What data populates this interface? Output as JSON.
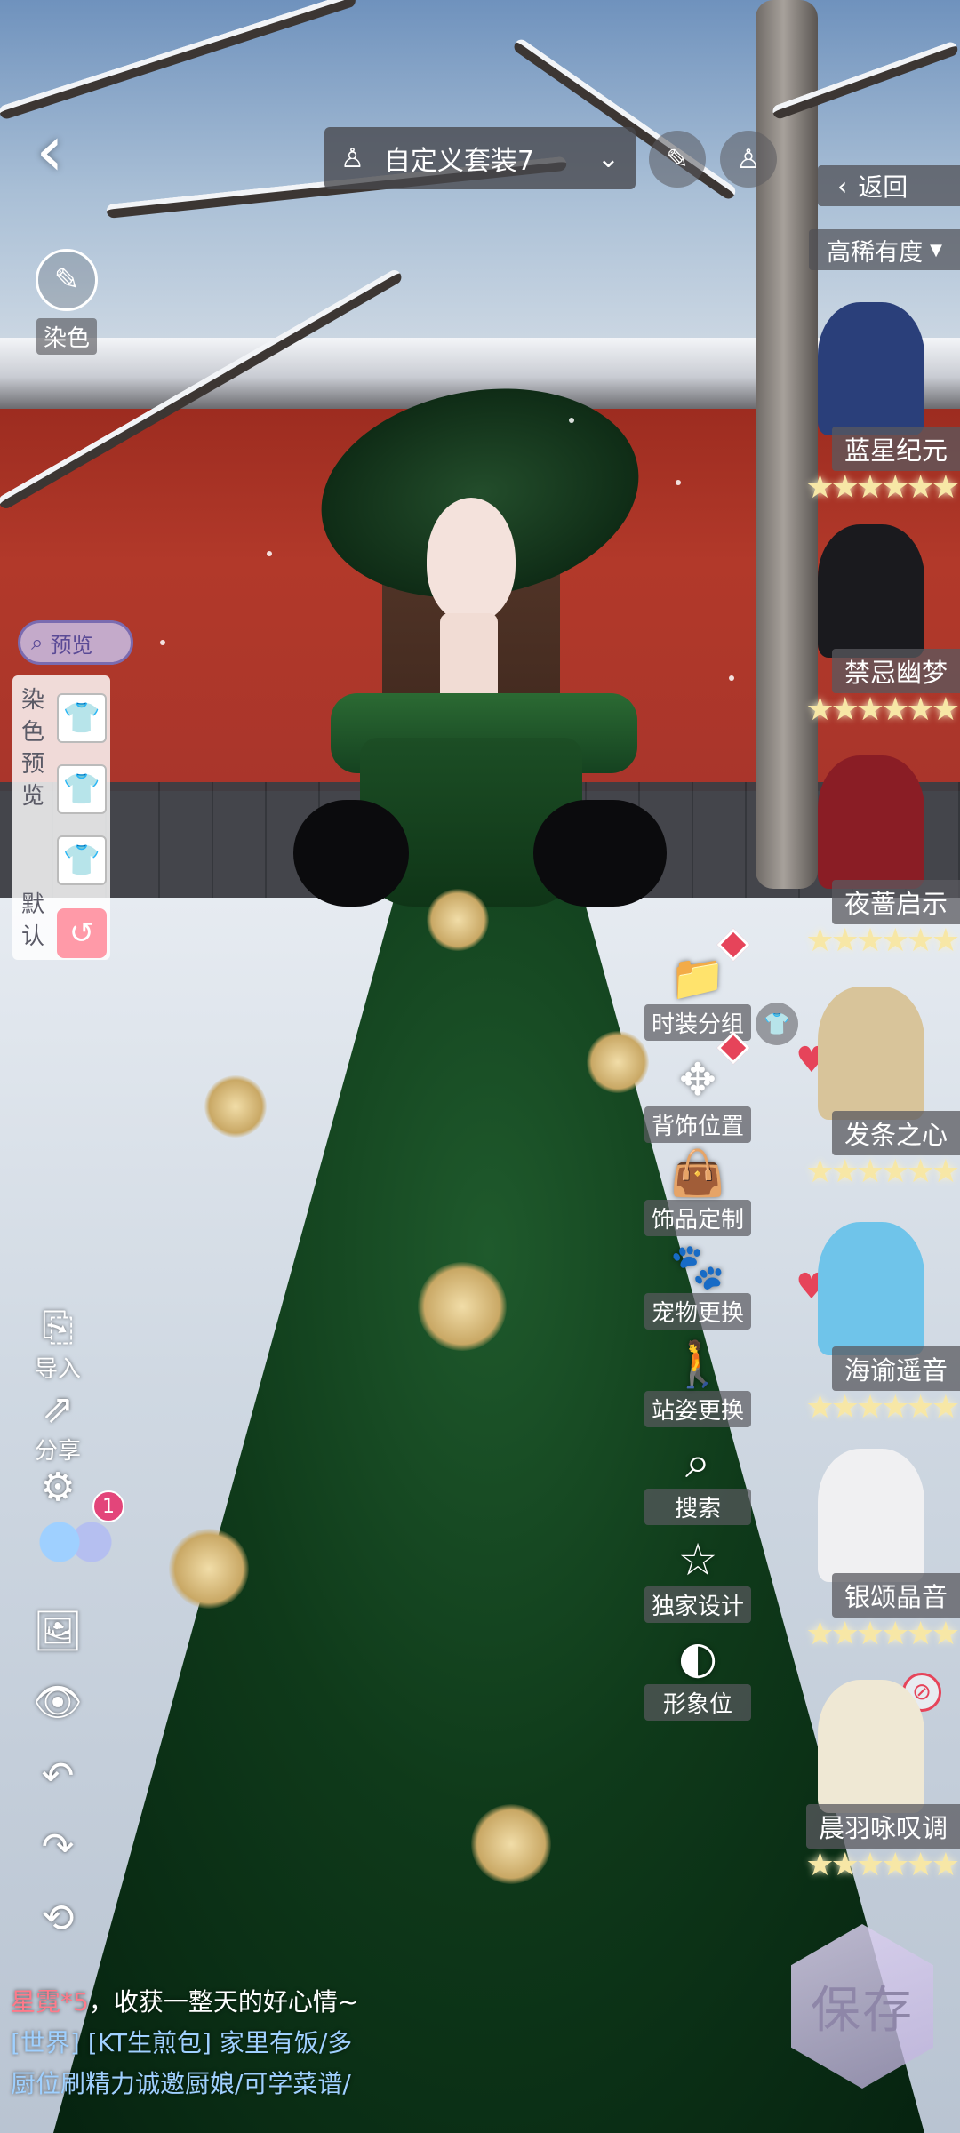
{
  "header": {
    "outfit_name": "自定义套装7",
    "back_label": "返回",
    "sort_label": "高稀有度"
  },
  "left_panel": {
    "dye_label": "染色",
    "preview_label": "预览",
    "dye_preview_label": "染色预览",
    "default_label": "默认",
    "tools": [
      {
        "label": "导入",
        "icon": "import-icon"
      },
      {
        "label": "分享",
        "icon": "share-icon"
      }
    ],
    "notification_count": "1"
  },
  "functions": [
    {
      "label": "时装分组",
      "icon": "folder-icon"
    },
    {
      "label": "背饰位置",
      "icon": "move-icon"
    },
    {
      "label": "饰品定制",
      "icon": "bag-icon"
    },
    {
      "label": "宠物更换",
      "icon": "paw-icon"
    },
    {
      "label": "站姿更换",
      "icon": "person-icon"
    },
    {
      "label": "搜索",
      "icon": "search-icon"
    },
    {
      "label": "独家设计",
      "icon": "star-icon"
    },
    {
      "label": "形象位",
      "icon": "portrait-icon"
    }
  ],
  "outfit_cards": [
    {
      "name": "蓝星纪元",
      "stars": "★★★★★★",
      "color": "#2a3f7a"
    },
    {
      "name": "禁忌幽梦",
      "stars": "★★★★★★",
      "color": "#1a1a1e"
    },
    {
      "name": "夜蔷启示",
      "stars": "★★★★★★",
      "color": "#8a1d25"
    },
    {
      "name": "发条之心",
      "stars": "★★★★★★",
      "color": "#d8c49a"
    },
    {
      "name": "海谕遥音",
      "stars": "★★★★★★",
      "color": "#6fc4ea"
    },
    {
      "name": "银颂晶音",
      "stars": "★★★★★★",
      "color": "#f0f0f2"
    },
    {
      "name": "晨羽咏叹调",
      "stars": "★★★★★★",
      "color": "#efe8d4"
    }
  ],
  "save_label": "保存",
  "chat": {
    "line1_name": "星霓*5",
    "line1_text": "，收获一整天的好心情~",
    "line2_channel": "[世界]",
    "line2_user": "[KT生煎包]",
    "line2_text": "家里有饭/多",
    "line3_text": "厨位刷精力诚邀厨娘/可学菜谱/"
  }
}
